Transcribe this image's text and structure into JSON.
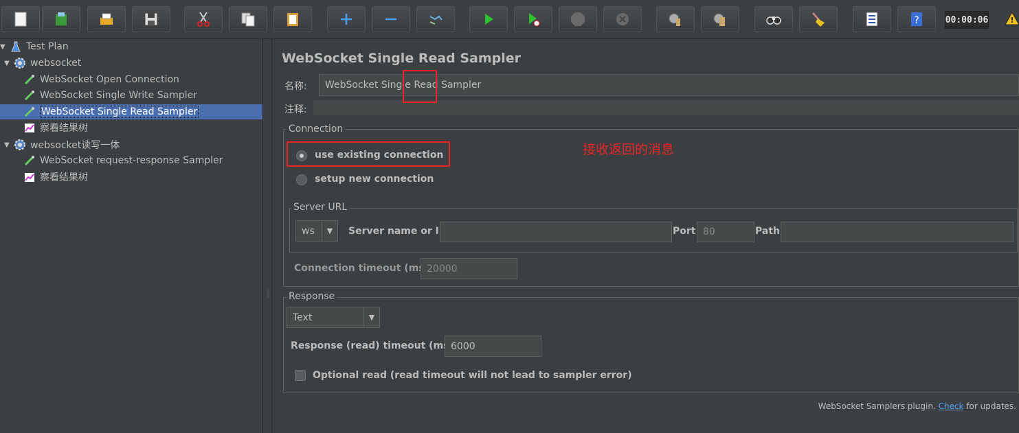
{
  "toolbar": {
    "timer": "00:00:06",
    "buttons": [
      "new-icon",
      "templates-icon",
      "open-icon",
      "save-icon",
      "cut-icon",
      "copy-icon",
      "paste-icon",
      "expand-icon",
      "collapse-icon",
      "toggle-icon",
      "start-icon",
      "start-no-pause-icon",
      "stop-icon",
      "shutdown-icon",
      "clear-icon",
      "clear-all-icon",
      "search-icon",
      "reset-search-icon",
      "function-helper-icon",
      "help-icon"
    ]
  },
  "tree": {
    "items": [
      {
        "label": "Test Plan"
      },
      {
        "label": "websocket"
      },
      {
        "label": "WebSocket Open Connection"
      },
      {
        "label": "WebSocket Single Write Sampler"
      },
      {
        "label": "WebSocket Single Read Sampler"
      },
      {
        "label": "察看结果树"
      },
      {
        "label": "websocket读写一体"
      },
      {
        "label": "WebSocket request-response Sampler"
      },
      {
        "label": "察看结果树"
      }
    ]
  },
  "panel": {
    "title": "WebSocket Single Read Sampler",
    "name_label": "名称:",
    "name_value": "WebSocket Single Read Sampler",
    "comment_label": "注释:",
    "comment_value": "",
    "connection": {
      "title": "Connection",
      "use_existing": "use existing connection",
      "setup_new": "setup new connection",
      "server_url": {
        "title": "Server URL",
        "protocol": "ws",
        "server_label": "Server name or IP:",
        "server_value": "",
        "port_label": "Port:",
        "port_value": "80",
        "path_label": "Path:",
        "path_value": ""
      },
      "timeout_label": "Connection timeout (ms):",
      "timeout_value": "20000"
    },
    "response": {
      "title": "Response",
      "type": "Text",
      "timeout_label": "Response (read) timeout (ms):",
      "timeout_value": "6000",
      "optional_read": "Optional read (read timeout will not lead to sampler error)"
    },
    "annotation": "接收返回的消息",
    "footer": {
      "prefix": "WebSocket Samplers plugin.",
      "link": "Check",
      "suffix": "for updates."
    }
  },
  "colors": {
    "background": "#3c3f41",
    "selection": "#4b6eaf",
    "annotation": "#e8262a",
    "link": "#589df6"
  }
}
